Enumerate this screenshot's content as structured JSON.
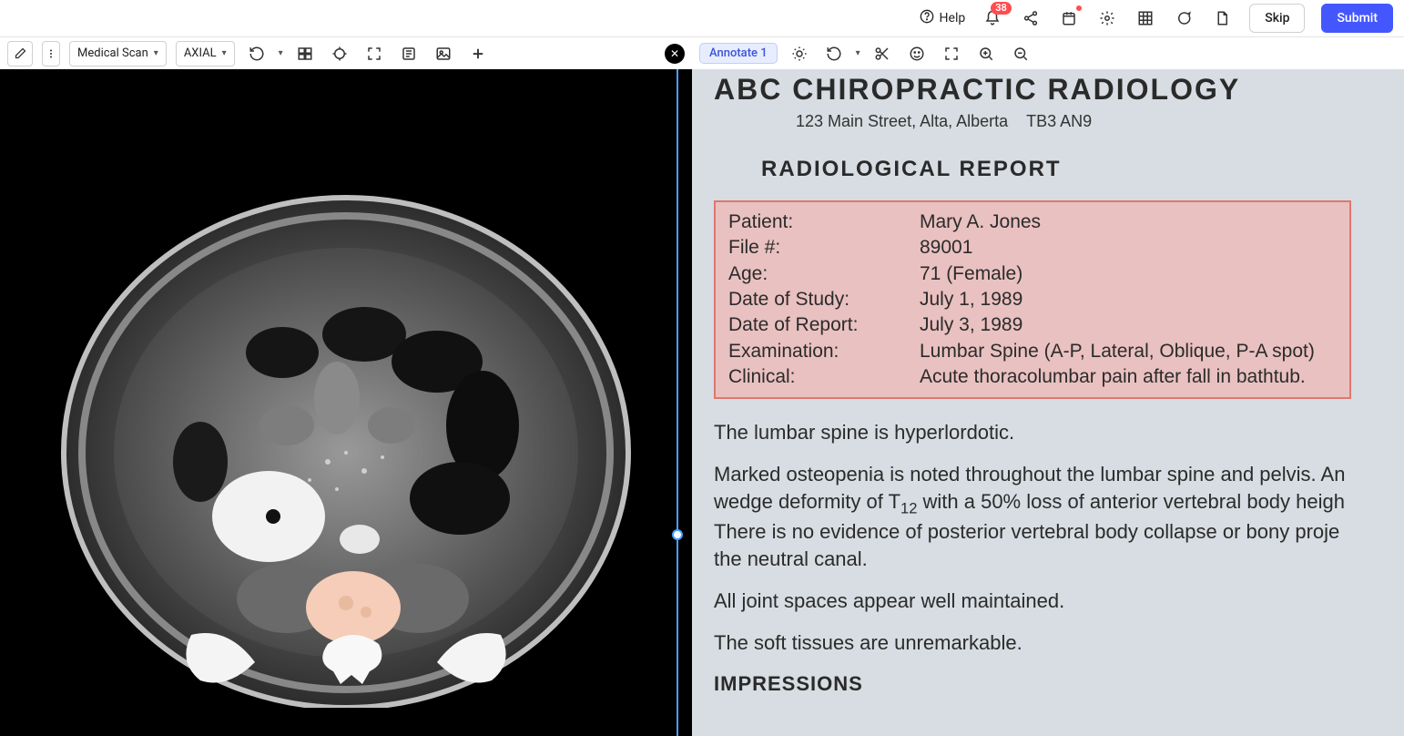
{
  "topbar": {
    "help": "Help",
    "notif_count": "38",
    "skip_label": "Skip",
    "submit_label": "Submit"
  },
  "toolbar": {
    "select_scan": "Medical Scan",
    "select_view": "AXIAL",
    "annotate_label": "Annotate 1"
  },
  "report": {
    "org_title": "ABC CHIROPRACTIC RADIOLOGY",
    "address_line": "123 Main Street, Alta, Alberta",
    "address_code": "TB3 AN9",
    "subtitle": "RADIOLOGICAL REPORT",
    "rows": {
      "patient_label": "Patient:",
      "patient_value": "Mary A. Jones",
      "file_label": "File #:",
      "file_value": "89001",
      "age_label": "Age:",
      "age_value": "71 (Female)",
      "study_label": "Date of Study:",
      "study_value": "July 1, 1989",
      "rep_label": "Date of Report:",
      "rep_value": "July 3, 1989",
      "exam_label": "Examination:",
      "exam_value": "Lumbar Spine (A-P, Lateral, Oblique, P-A spot)",
      "clin_label": "Clinical:",
      "clin_value": "Acute thoracolumbar pain after fall in bathtub."
    },
    "p1": "The lumbar spine is hyperlordotic.",
    "p2a": "Marked osteopenia is noted throughout the lumbar spine and pelvis. An",
    "p2b_pre": "wedge deformity of T",
    "p2b_sub": "12",
    "p2b_post": " with a 50% loss of anterior vertebral body heigh",
    "p2c": "There is no evidence of posterior vertebral body collapse or bony proje",
    "p2d": "the neutral canal.",
    "p3": "All joint spaces appear well maintained.",
    "p4": "The soft tissues are unremarkable.",
    "impressions": "IMPRESSIONS"
  }
}
